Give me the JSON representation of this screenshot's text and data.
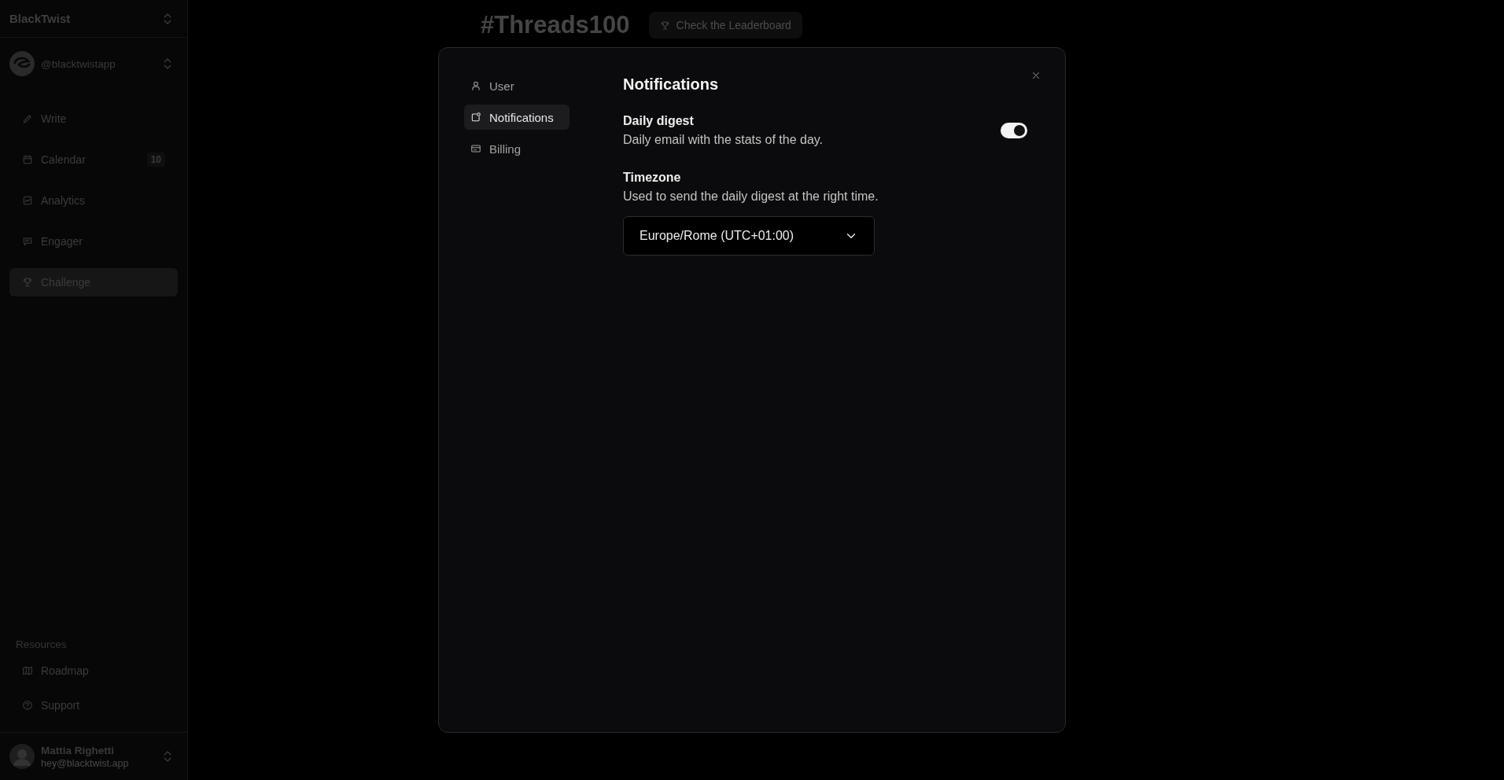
{
  "sidebar": {
    "brand": "BlackTwist",
    "account": "@blacktwistapp",
    "nav": [
      {
        "label": "Write",
        "selected": false
      },
      {
        "label": "Calendar",
        "badge": "10",
        "selected": false
      },
      {
        "label": "Analytics",
        "selected": false
      },
      {
        "label": "Engager",
        "selected": false
      },
      {
        "label": "Challenge",
        "selected": true
      }
    ],
    "resources_heading": "Resources",
    "resources": [
      {
        "label": "Roadmap"
      },
      {
        "label": "Support"
      }
    ],
    "user": {
      "name": "Mattia Righetti",
      "email": "hey@blacktwist.app"
    }
  },
  "page": {
    "title": "#Threads100",
    "leaderboard_button": "Check the Leaderboard"
  },
  "modal": {
    "nav": [
      {
        "label": "User",
        "selected": false
      },
      {
        "label": "Notifications",
        "selected": true
      },
      {
        "label": "Billing",
        "selected": false
      }
    ],
    "title": "Notifications",
    "settings": [
      {
        "kind": "toggle",
        "label": "Daily digest",
        "description": "Daily email with the stats of the day.",
        "on": true
      },
      {
        "kind": "select",
        "label": "Timezone",
        "description": "Used to send the daily digest at the right time.",
        "value": "Europe/Rome (UTC+01:00)"
      }
    ]
  }
}
